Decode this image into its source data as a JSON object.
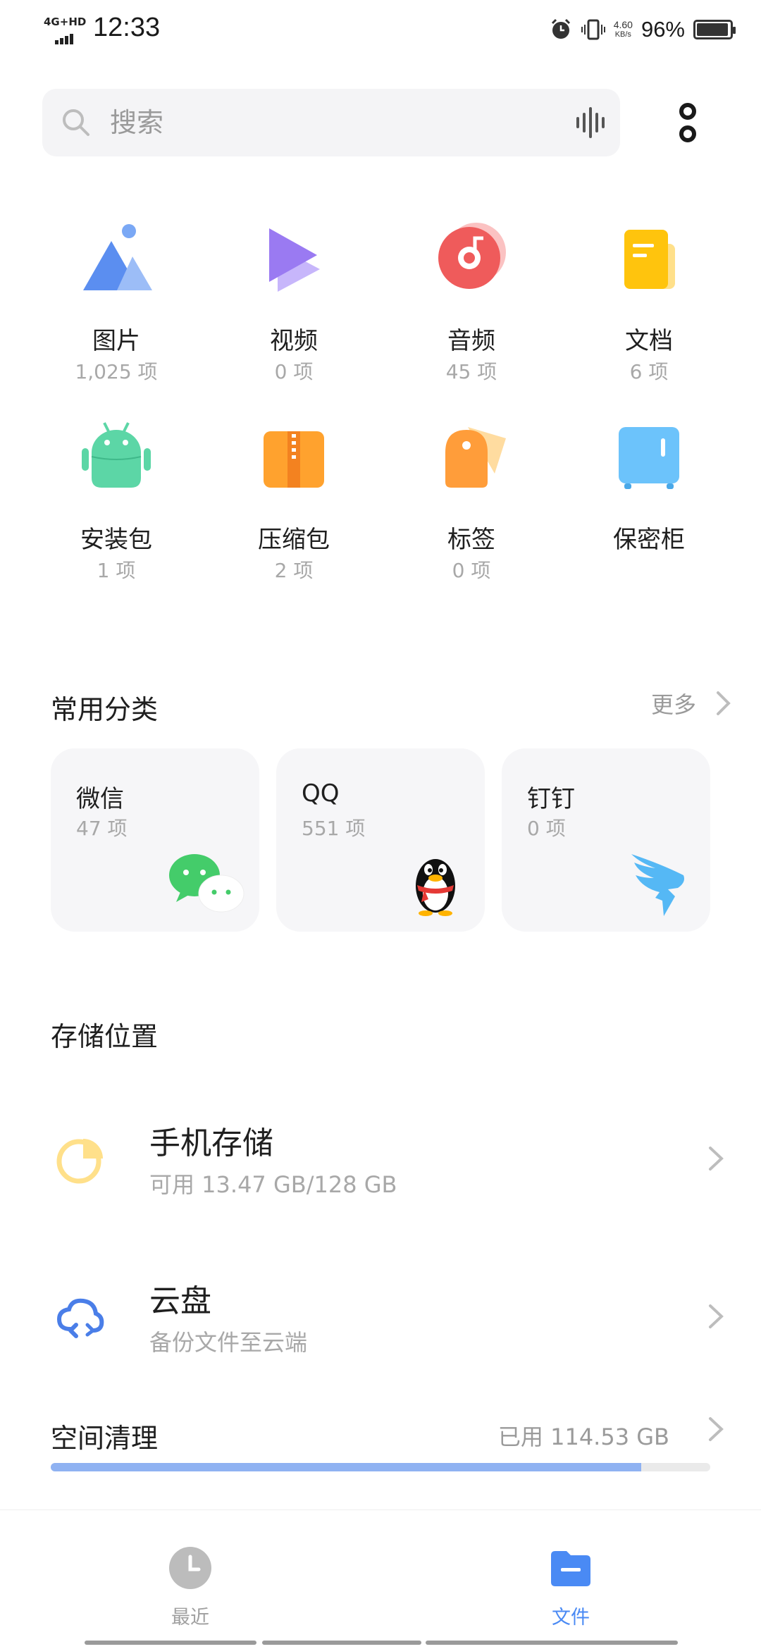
{
  "status_bar": {
    "network": "4G+HD",
    "time": "12:33",
    "speed_value": "4.60",
    "speed_unit": "KB/s",
    "battery": "96%",
    "battery_level": 0.96
  },
  "search": {
    "placeholder": "搜索"
  },
  "categories": [
    {
      "name": "图片",
      "count": "1,025 项",
      "icon": "image-icon"
    },
    {
      "name": "视频",
      "count": "0 项",
      "icon": "video-icon"
    },
    {
      "name": "音频",
      "count": "45 项",
      "icon": "audio-icon"
    },
    {
      "name": "文档",
      "count": "6 项",
      "icon": "document-icon"
    },
    {
      "name": "安装包",
      "count": "1 项",
      "icon": "apk-icon"
    },
    {
      "name": "压缩包",
      "count": "2 项",
      "icon": "zip-icon"
    },
    {
      "name": "标签",
      "count": "0 项",
      "icon": "tag-icon"
    },
    {
      "name": "保密柜",
      "count": "",
      "icon": "safe-icon"
    }
  ],
  "common": {
    "title": "常用分类",
    "more": "更多",
    "apps": [
      {
        "name": "微信",
        "count": "47 项",
        "icon": "wechat-icon"
      },
      {
        "name": "QQ",
        "count": "551 项",
        "icon": "qq-icon"
      },
      {
        "name": "钉钉",
        "count": "0 项",
        "icon": "dingtalk-icon"
      }
    ]
  },
  "storage": {
    "title": "存储位置",
    "items": [
      {
        "name": "手机存储",
        "detail": "可用 13.47 GB/128 GB",
        "icon": "pie-chart-icon"
      },
      {
        "name": "云盘",
        "detail": "备份文件至云端",
        "icon": "cloud-sync-icon"
      }
    ]
  },
  "clean": {
    "title": "空间清理",
    "used": "已用 114.53 GB",
    "used_fraction": 0.895
  },
  "bottom_nav": {
    "items": [
      {
        "label": "最近",
        "icon": "clock-icon",
        "active": false
      },
      {
        "label": "文件",
        "icon": "folder-icon",
        "active": true
      }
    ]
  },
  "colors": {
    "accent": "#4a8af4",
    "muted": "#a8a8a8",
    "progress": "#8fb2f2"
  }
}
